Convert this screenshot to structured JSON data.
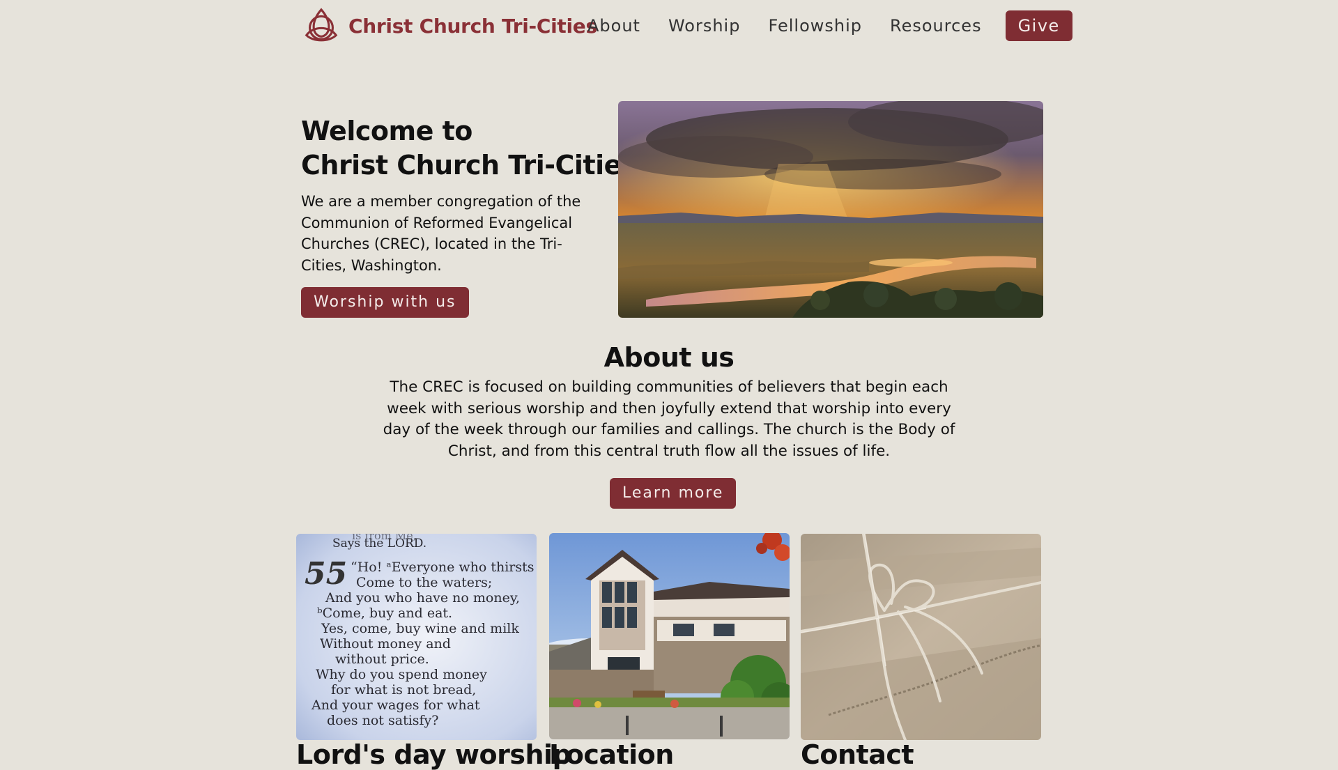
{
  "site": {
    "name": "Christ Church Tri-Cities",
    "logo_icon": "triquetra-icon",
    "accent_color": "#7f2d33",
    "background_color": "#e6e3db"
  },
  "nav": {
    "items": [
      {
        "label": "About"
      },
      {
        "label": "Worship"
      },
      {
        "label": "Fellowship"
      },
      {
        "label": "Resources"
      }
    ],
    "give_label": "Give"
  },
  "hero": {
    "title_line1": "Welcome to",
    "title_line2": "Christ Church Tri-Cities",
    "body": "We are a member congregation of the Communion of Reformed Evangelical Churches (CREC), located in the Tri-Cities, Washington.",
    "button_label": "Worship with us",
    "image": "sunset-over-wetland-landscape"
  },
  "about": {
    "title": "About us",
    "body": "The CREC is focused on building communities of believers that begin each week with serious worship and then joyfully extend that worship into every day of the week through our families and callings. The church is the Body of Christ, and from this central truth flow all the issues of life.",
    "button_label": "Learn more"
  },
  "cards": [
    {
      "title": "Lord's day worship",
      "image": "isaiah-55-bible-page",
      "image_text": {
        "line0": "is from Me,",
        "line1": "Says the LORD.",
        "chapter": "55",
        "v1": "“Ho! ᵃEveryone who thirsts",
        "v2": "Come to the waters;",
        "v3": "And you who have no money,",
        "v4": "ᵇCome, buy and eat.",
        "v5": "Yes, come, buy wine and milk",
        "v6": "Without money and",
        "v7": "without price.",
        "v8": "Why do you spend money",
        "v9": "for what is not bread,",
        "v10": "And your wages for what",
        "v11": "does not satisfy?"
      }
    },
    {
      "title": "Location",
      "image": "church-building-exterior"
    },
    {
      "title": "Contact",
      "image": "twine-wrapped-paper-package"
    }
  ]
}
